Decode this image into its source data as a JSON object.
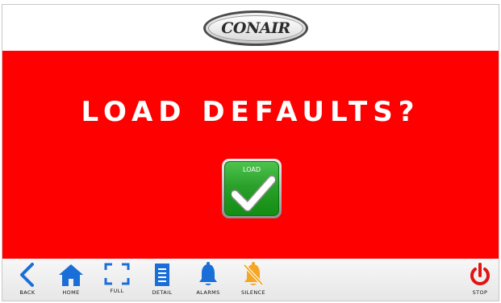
{
  "brand": {
    "logo_text": "CONAIR"
  },
  "dialog": {
    "title": "LOAD DEFAULTS?",
    "confirm_label": "LOAD"
  },
  "nav": {
    "back": "BACK",
    "home": "HOME",
    "full": "FULL",
    "detail": "DETAIL",
    "alarms": "ALARMS",
    "silence": "SILENCE",
    "stop": "STOP"
  },
  "colors": {
    "background": "#ff0000",
    "nav_icon": "#1a6ed8",
    "silence_icon": "#f5a623",
    "stop_icon": "#e11414",
    "confirm_green": "#2ba12b"
  }
}
